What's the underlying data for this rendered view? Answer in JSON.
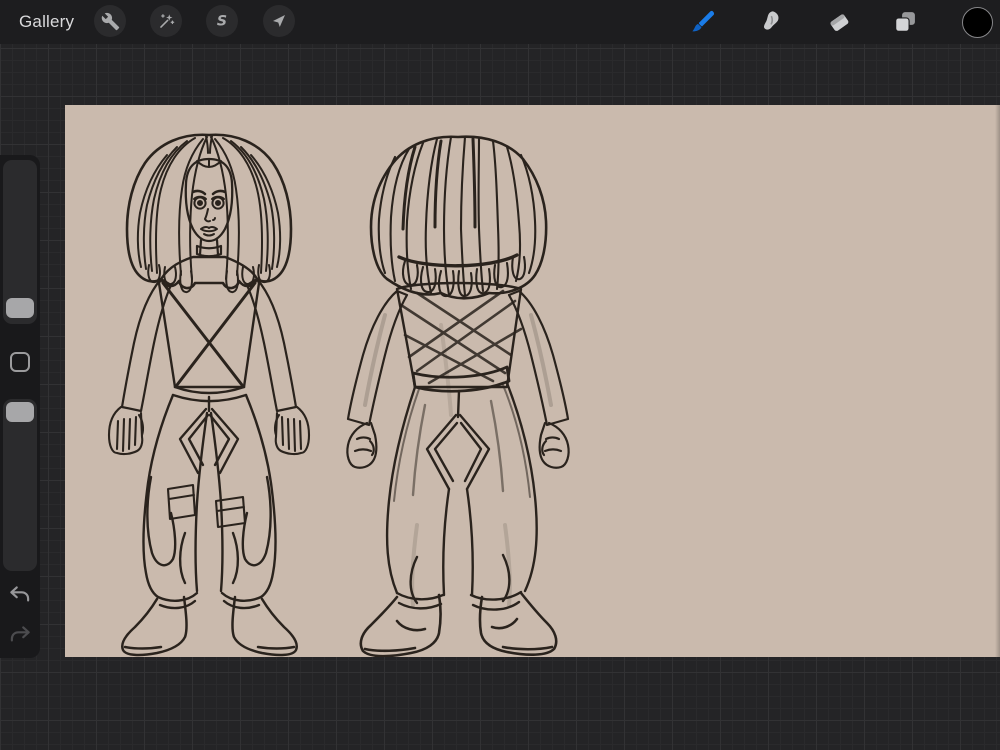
{
  "app": {
    "name": "Procreate-style painting app",
    "view": "canvas-editor"
  },
  "topbar": {
    "gallery_label": "Gallery",
    "left_tools": [
      {
        "id": "actions",
        "icon": "wrench-icon",
        "label": "Actions"
      },
      {
        "id": "adjustments",
        "icon": "magic-wand-icon",
        "label": "Adjustments"
      },
      {
        "id": "selection",
        "icon": "selection-s-icon",
        "label": "Selection"
      },
      {
        "id": "transform",
        "icon": "transform-arrow-icon",
        "label": "Transform"
      }
    ],
    "right_tools": [
      {
        "id": "paint",
        "icon": "paintbrush-icon",
        "label": "Paint",
        "active": true
      },
      {
        "id": "smudge",
        "icon": "smudge-icon",
        "label": "Smudge",
        "active": false
      },
      {
        "id": "erase",
        "icon": "eraser-icon",
        "label": "Erase",
        "active": false
      },
      {
        "id": "layers",
        "icon": "layers-icon",
        "label": "Layers",
        "active": false
      },
      {
        "id": "color",
        "icon": "color-swatch",
        "label": "Color",
        "value": "#000000"
      }
    ],
    "colors": {
      "bar_bg": "#1d1d1f",
      "icon_circle_bg": "#2b2b2d",
      "icon_color": "#a9aaac",
      "active_accent": "#1a7ce8",
      "gallery_text": "#d9d9db"
    }
  },
  "sidebar": {
    "brush_size_slider": {
      "label": "Brush size",
      "orientation": "vertical"
    },
    "modify_button": {
      "label": "Modify",
      "icon": "modify-square-icon"
    },
    "opacity_slider": {
      "label": "Brush opacity",
      "orientation": "vertical"
    },
    "undo": {
      "label": "Undo",
      "icon": "undo-arrow-icon",
      "enabled": true
    },
    "redo": {
      "label": "Redo",
      "icon": "redo-arrow-icon",
      "enabled": false
    }
  },
  "canvas": {
    "background_color": "#cabaad",
    "ink_color": "#2a231d",
    "artwork_description": "Hand-drawn character concept sketch: front view and back view of a figure with long dreadlocks, fishnet mesh top, baggy cargo pants with diamond seams and pockets, and boots",
    "views": [
      "front",
      "back"
    ]
  },
  "workspace": {
    "background_color": "#242426",
    "grid": true
  }
}
